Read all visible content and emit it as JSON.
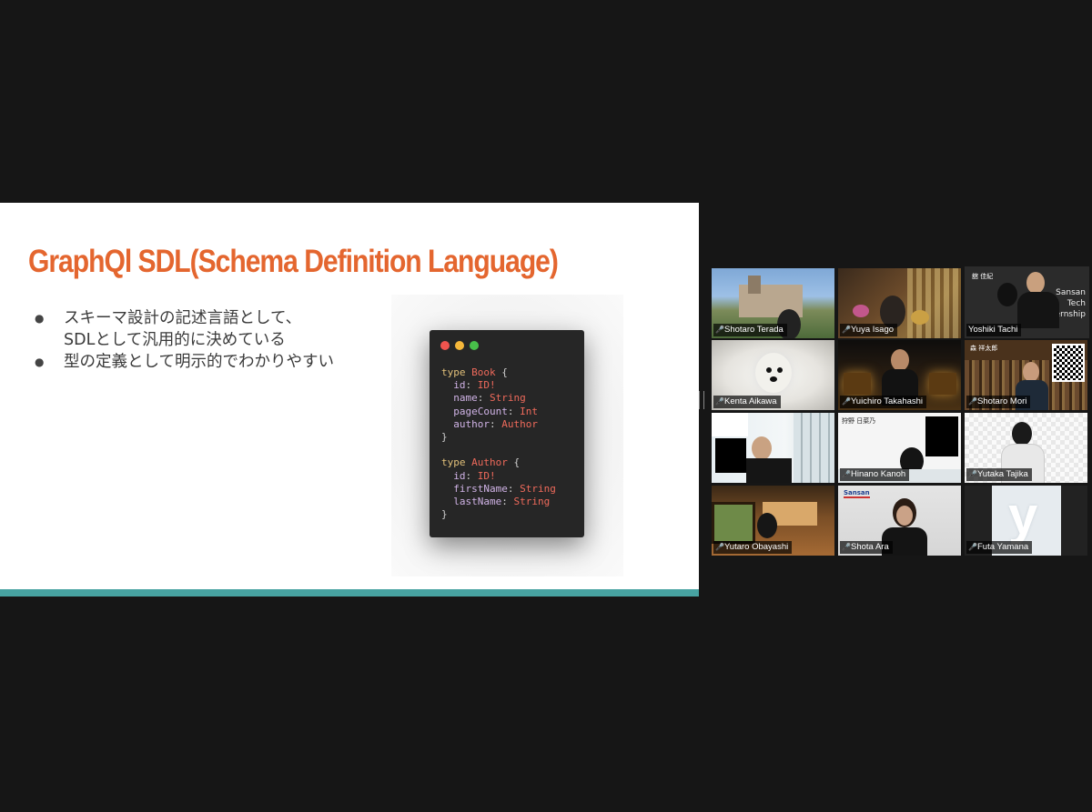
{
  "slide": {
    "title": "GraphQl SDL(Schema Definition Language)",
    "bullets": [
      "スキーマ設計の記述言語として、\nSDLとして汎用的に決めている",
      "型の定義として明示的でわかりやすい"
    ],
    "code_window": {
      "traffic_lights": [
        "#f0544e",
        "#f5b73a",
        "#48c04a"
      ],
      "lines": [
        [
          [
            "kw",
            "type"
          ],
          [
            "pu",
            " "
          ],
          [
            "ty",
            "Book"
          ],
          [
            "pu",
            " {"
          ]
        ],
        [
          [
            "pu",
            "  "
          ],
          [
            "fd",
            "id"
          ],
          [
            "pu",
            ": "
          ],
          [
            "ty",
            "ID!"
          ]
        ],
        [
          [
            "pu",
            "  "
          ],
          [
            "fd",
            "name"
          ],
          [
            "pu",
            ": "
          ],
          [
            "ty",
            "String"
          ]
        ],
        [
          [
            "pu",
            "  "
          ],
          [
            "fd",
            "pageCount"
          ],
          [
            "pu",
            ": "
          ],
          [
            "ty",
            "Int"
          ]
        ],
        [
          [
            "pu",
            "  "
          ],
          [
            "fd",
            "author"
          ],
          [
            "pu",
            ": "
          ],
          [
            "ty",
            "Author"
          ]
        ],
        [
          [
            "pu",
            "}"
          ]
        ],
        [
          [
            "pu",
            ""
          ]
        ],
        [
          [
            "kw",
            "type"
          ],
          [
            "pu",
            " "
          ],
          [
            "ty",
            "Author"
          ],
          [
            "pu",
            " {"
          ]
        ],
        [
          [
            "pu",
            "  "
          ],
          [
            "fd",
            "id"
          ],
          [
            "pu",
            ": "
          ],
          [
            "ty",
            "ID!"
          ]
        ],
        [
          [
            "pu",
            "  "
          ],
          [
            "fd",
            "firstName"
          ],
          [
            "pu",
            ": "
          ],
          [
            "ty",
            "String"
          ]
        ],
        [
          [
            "pu",
            "  "
          ],
          [
            "fd",
            "lastName"
          ],
          [
            "pu",
            ": "
          ],
          [
            "ty",
            "String"
          ]
        ],
        [
          [
            "pu",
            "}"
          ]
        ]
      ]
    },
    "accent_color": "#e4662f",
    "bar_color": "#47a2a1"
  },
  "gallery": {
    "mic_icon": "mic-muted-icon",
    "participants": [
      {
        "name": "Shotaro Terada",
        "muted": true,
        "active": false
      },
      {
        "name": "Yuya Isago",
        "muted": true,
        "active": false
      },
      {
        "name": "Yoshiki Tachi",
        "muted": false,
        "active": true,
        "slide_text": [
          "舘 佳紀",
          "Sansan",
          "Tech",
          "ernship"
        ]
      },
      {
        "name": "Kenta Aikawa",
        "muted": true,
        "active": false
      },
      {
        "name": "Yuichiro Takahashi",
        "muted": true,
        "active": false
      },
      {
        "name": "Shotaro Mori",
        "muted": true,
        "active": false,
        "slide_text": [
          "森 祥太郎"
        ]
      },
      {
        "name": "",
        "muted": true,
        "active": false
      },
      {
        "name": "Hinano Kanoh",
        "muted": true,
        "active": false,
        "slide_text": [
          "狩野 日菜乃"
        ]
      },
      {
        "name": "Yutaka Tajika",
        "muted": true,
        "active": false
      },
      {
        "name": "Yutaro Obayashi",
        "muted": true,
        "active": false
      },
      {
        "name": "Shota Ara",
        "muted": true,
        "active": false,
        "slide_text": [
          "Sansan"
        ]
      },
      {
        "name": "Futa Yamana",
        "muted": true,
        "active": false,
        "slide_text": [
          "y"
        ]
      }
    ]
  }
}
